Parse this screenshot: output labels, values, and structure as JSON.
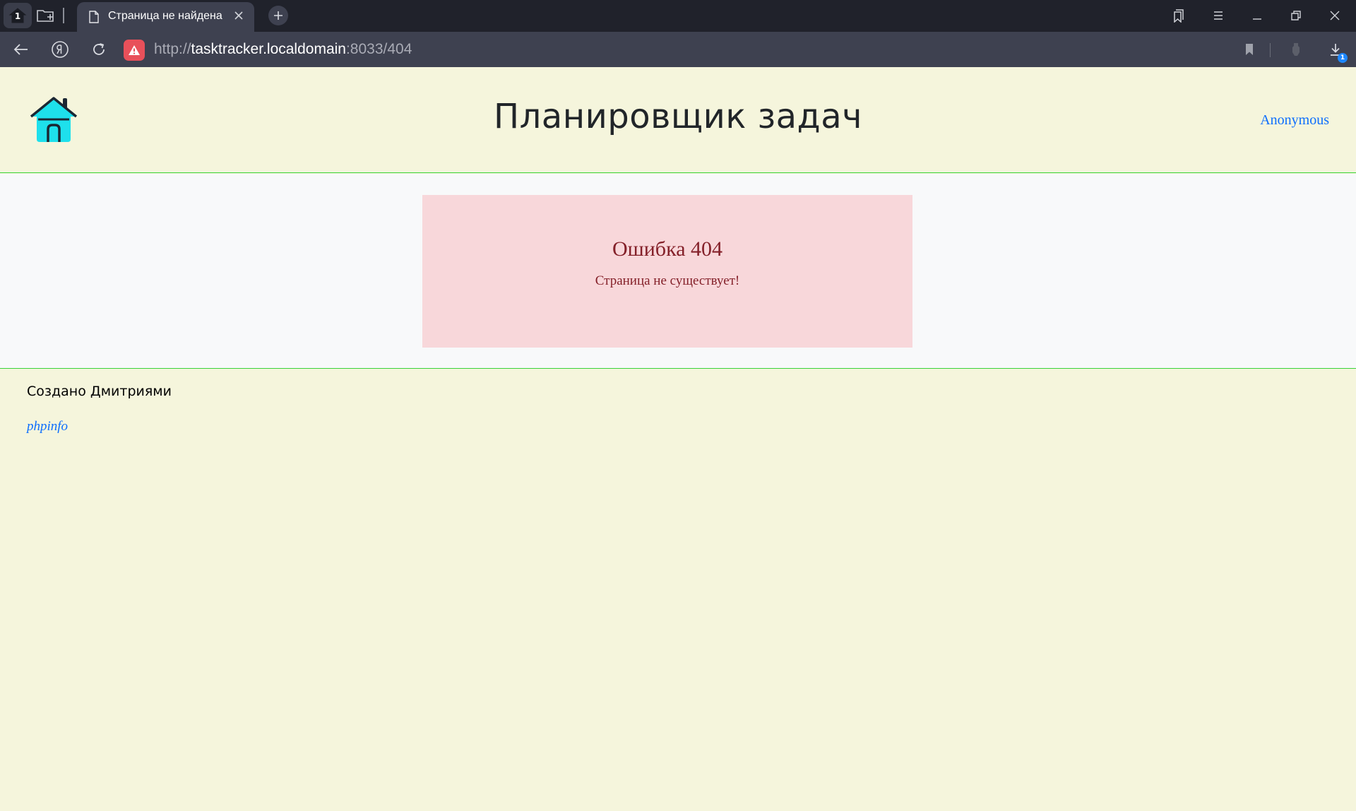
{
  "browser": {
    "tab_count": "1",
    "tab_title": "Страница не найдена",
    "url_scheme": "http://",
    "url_host": "tasktracker.localdomain",
    "url_path": ":8033/404",
    "downloads_count": "1",
    "warning_color": "#e8505a"
  },
  "header": {
    "title": "Планировщик задач",
    "user_link": "Anonymous",
    "logo_icon": "house-icon",
    "logo_color": "#1ee0ec"
  },
  "error": {
    "title": "Ошибка 404",
    "message": "Страница не существует!",
    "background": "#f8d7da",
    "text_color": "#842029"
  },
  "footer": {
    "credit": "Создано Дмитриями",
    "link": "phpinfo"
  },
  "colors": {
    "page_background": "#f5f5dc",
    "divider": "#39d439",
    "link": "#0d6efd"
  }
}
